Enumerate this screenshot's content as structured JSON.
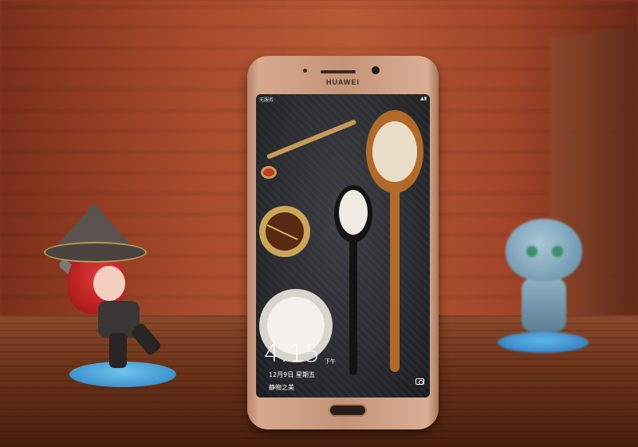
{
  "phone": {
    "brand": "HUAWEI",
    "status_left": "无服务",
    "status_right": "▲▮",
    "lockscreen": {
      "time": "4:15",
      "ampm": "下午",
      "date": "12月9日",
      "weekday": "星期五",
      "caption": "静物之美"
    }
  },
  "icons": {
    "camera": "camera-icon"
  },
  "colors": {
    "phone_body": "#c49478",
    "base_blue": "#2b7fc0",
    "wall_brick": "#a84a2c"
  }
}
